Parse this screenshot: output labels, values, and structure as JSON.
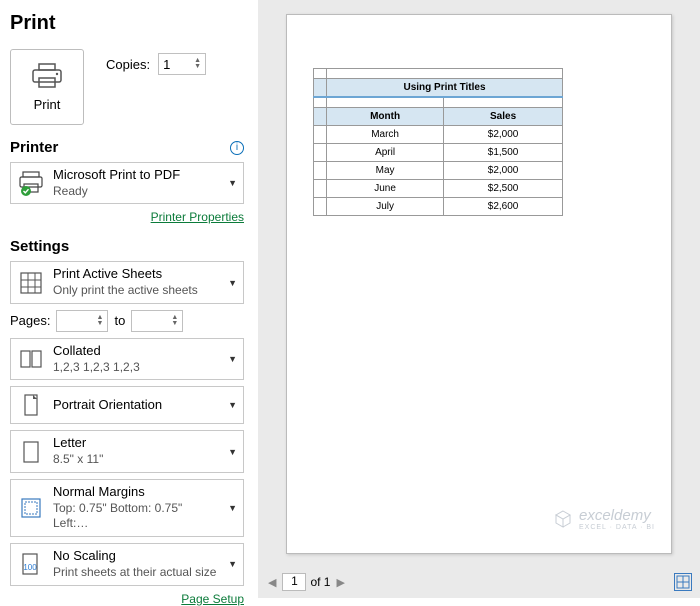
{
  "title": "Print",
  "printButton": {
    "label": "Print"
  },
  "copies": {
    "label": "Copies:",
    "value": "1"
  },
  "printerSection": {
    "heading": "Printer"
  },
  "printer": {
    "name": "Microsoft Print to PDF",
    "status": "Ready"
  },
  "printerPropsLink": "Printer Properties",
  "settingsSection": {
    "heading": "Settings"
  },
  "settings": {
    "scope": {
      "line1": "Print Active Sheets",
      "line2": "Only print the active sheets"
    },
    "pagesLabel": "Pages:",
    "pagesTo": "to",
    "collate": {
      "line1": "Collated",
      "line2": "1,2,3    1,2,3    1,2,3"
    },
    "orientation": {
      "line1": "Portrait Orientation"
    },
    "paper": {
      "line1": "Letter",
      "line2": "8.5\" x 11\""
    },
    "margins": {
      "line1": "Normal Margins",
      "line2": "Top: 0.75\" Bottom: 0.75\" Left:…"
    },
    "scaling": {
      "line1": "No Scaling",
      "line2": "Print sheets at their actual size"
    }
  },
  "pageSetupLink": "Page Setup",
  "chart_data": {
    "type": "table",
    "title": "Using Print Titles",
    "columns": [
      "Month",
      "Sales"
    ],
    "rows": [
      [
        "March",
        "$2,000"
      ],
      [
        "April",
        "$1,500"
      ],
      [
        "May",
        "$2,000"
      ],
      [
        "June",
        "$2,500"
      ],
      [
        "July",
        "$2,600"
      ]
    ]
  },
  "watermark": {
    "brand": "exceldemy",
    "tagline": "EXCEL · DATA · BI"
  },
  "pager": {
    "current": "1",
    "total": "of 1"
  }
}
